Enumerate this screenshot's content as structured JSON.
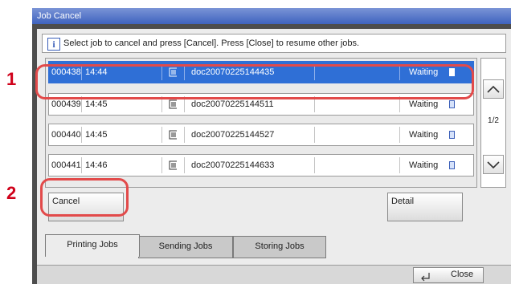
{
  "callouts": [
    "1",
    "2"
  ],
  "window": {
    "title": "Job Cancel"
  },
  "info": {
    "message": "Select job to cancel and press [Cancel]. Press [Close] to resume other jobs."
  },
  "jobs": [
    {
      "id": "000438",
      "time": "14:44",
      "name": "doc20070225144435",
      "status": "Waiting",
      "selected": true
    },
    {
      "id": "000439",
      "time": "14:45",
      "name": "doc20070225144511",
      "status": "Waiting",
      "selected": false
    },
    {
      "id": "000440",
      "time": "14:45",
      "name": "doc20070225144527",
      "status": "Waiting",
      "selected": false
    },
    {
      "id": "000441",
      "time": "14:46",
      "name": "doc20070225144633",
      "status": "Waiting",
      "selected": false
    }
  ],
  "pagination": {
    "page": "1/2"
  },
  "buttons": {
    "cancel": "Cancel",
    "detail": "Detail",
    "close": "Close"
  },
  "tabs": [
    {
      "label": "Printing Jobs",
      "active": true
    },
    {
      "label": "Sending Jobs",
      "active": false
    },
    {
      "label": "Storing Jobs",
      "active": false
    }
  ],
  "colors": {
    "highlight_ring": "#e24a4a",
    "callout": "#d0021b",
    "selected_row": "#2f6fd6"
  }
}
